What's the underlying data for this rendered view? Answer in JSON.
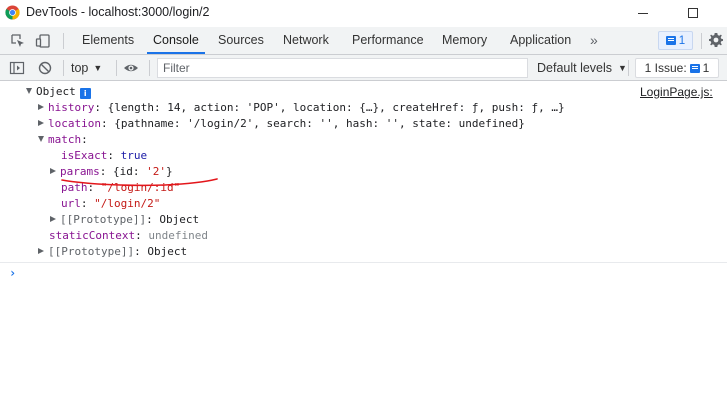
{
  "window": {
    "title": "DevTools - localhost:3000/login/2"
  },
  "tabs": [
    {
      "label": "Elements"
    },
    {
      "label": "Console"
    },
    {
      "label": "Sources"
    },
    {
      "label": "Network"
    },
    {
      "label": "Performance"
    },
    {
      "label": "Memory"
    },
    {
      "label": "Application"
    }
  ],
  "toolbar": {
    "more_tabs": "»",
    "messages_count": "1"
  },
  "console_toolbar": {
    "context": "top",
    "filter_placeholder": "Filter",
    "levels": "Default levels",
    "issues": "1 Issue:",
    "issues_count": "1"
  },
  "log": {
    "source": "LoginPage.js:",
    "root": "Object",
    "info_badge": "i",
    "rows": {
      "history_key": "history",
      "history_val": "{length: 14, action: 'POP', location: {…}, createHref: ƒ, push: ƒ, …}",
      "location_key": "location",
      "location_val": "{pathname: '/login/2', search: '', hash: '', state: undefined}",
      "match_key": "match",
      "isExact_key": "isExact",
      "isExact_val": "true",
      "params_key": "params",
      "params_val_open": "{id: ",
      "params_val_str": "'2'",
      "params_val_close": "}",
      "path_key": "path",
      "path_val": "\"/login/:id\"",
      "url_key": "url",
      "url_val": "\"/login/2\"",
      "proto_key": "[[Prototype]]",
      "proto_val": "Object",
      "staticContext_key": "staticContext",
      "staticContext_val": "undefined",
      "root_proto_key": "[[Prototype]]",
      "root_proto_val": "Object"
    },
    "prompt": "›"
  },
  "colors": {
    "accent": "#1a73e8",
    "annotation": "#e3161b"
  }
}
